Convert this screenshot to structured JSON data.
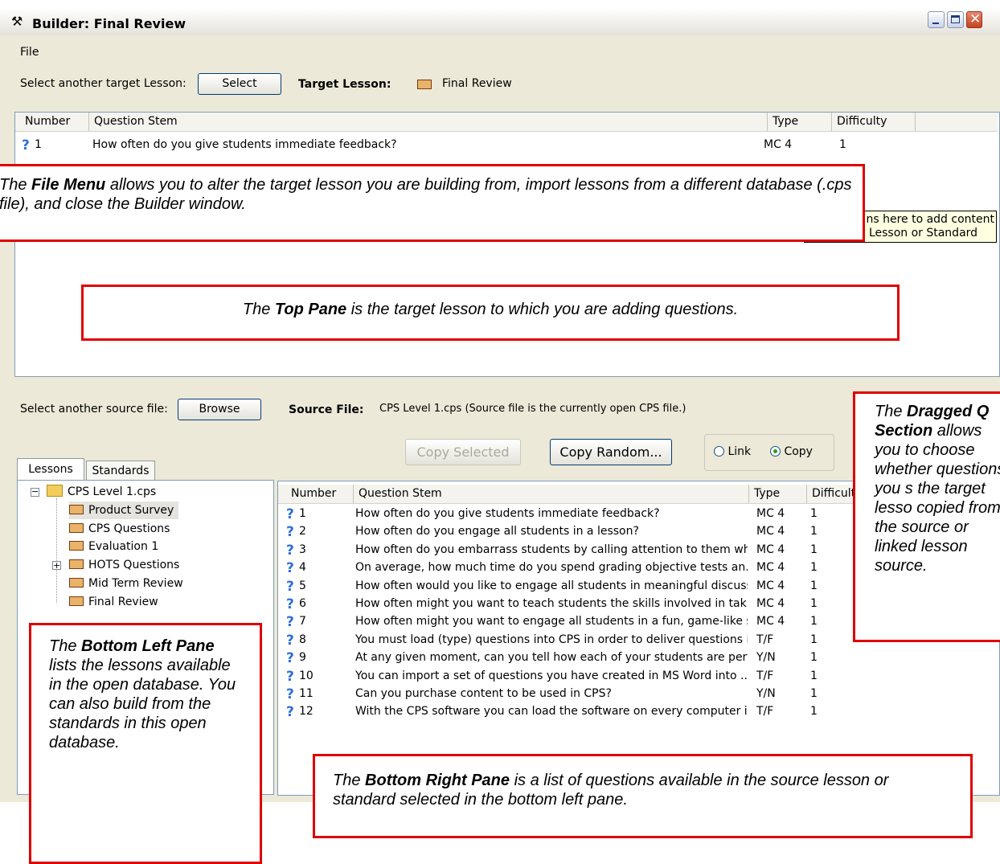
{
  "window": {
    "title": "Builder: Final Review"
  },
  "menu": {
    "file": "File"
  },
  "target": {
    "select_label": "Select another target Lesson:",
    "select_button": "Select",
    "target_label": "Target Lesson:",
    "target_value": "Final Review"
  },
  "top_table": {
    "headers": {
      "number": "Number",
      "stem": "Question Stem",
      "type": "Type",
      "difficulty": "Difficulty"
    },
    "rows": [
      {
        "number": "1",
        "stem": "How often do you give students immediate feedback?",
        "type": "MC 4",
        "difficulty": "1"
      }
    ]
  },
  "tooltip": {
    "line1": "ns here to add content",
    "line2": "t Lesson or Standard"
  },
  "source": {
    "select_label": "Select another source file:",
    "browse_button": "Browse",
    "source_label": "Source File:",
    "source_value": "CPS Level 1.cps  (Source file is the currently open CPS file.)",
    "copy_selected": "Copy Selected",
    "copy_random": "Copy Random...",
    "link_label": "Link",
    "copy_label": "Copy"
  },
  "tabs": {
    "lessons": "Lessons",
    "standards": "Standards"
  },
  "tree": {
    "root": "CPS Level 1.cps",
    "items": [
      {
        "label": "Product Survey"
      },
      {
        "label": "CPS Questions"
      },
      {
        "label": "Evaluation 1"
      },
      {
        "label": "HOTS Questions"
      },
      {
        "label": "Mid Term Review"
      },
      {
        "label": "Final Review"
      }
    ]
  },
  "bottom_table": {
    "headers": {
      "number": "Number",
      "stem": "Question Stem",
      "type": "Type",
      "difficulty": "Difficult"
    },
    "rows": [
      {
        "number": "1",
        "stem": "How often do you give students immediate feedback?",
        "type": "MC 4",
        "difficulty": "1"
      },
      {
        "number": "2",
        "stem": "How often do you engage all students in a lesson?",
        "type": "MC 4",
        "difficulty": "1"
      },
      {
        "number": "3",
        "stem": "How often do you embarrass students by calling attention to them whe...",
        "type": "MC 4",
        "difficulty": "1"
      },
      {
        "number": "4",
        "stem": "On average, how much time do you spend  grading objective tests an...",
        "type": "MC 4",
        "difficulty": "1"
      },
      {
        "number": "5",
        "stem": "How often would you like to engage all students in meaningful discussi...",
        "type": "MC 4",
        "difficulty": "1"
      },
      {
        "number": "6",
        "stem": "How often might you want to teach students the skills involved in takin...",
        "type": "MC 4",
        "difficulty": "1"
      },
      {
        "number": "7",
        "stem": "How often might you want to engage all students in a fun, game-like st...",
        "type": "MC 4",
        "difficulty": "1"
      },
      {
        "number": "8",
        "stem": "You must load (type) questions into CPS in order to deliver questions in...",
        "type": "T/F",
        "difficulty": "1"
      },
      {
        "number": "9",
        "stem": "At any given moment, can you tell how each of your students are perf...",
        "type": "Y/N",
        "difficulty": "1"
      },
      {
        "number": "10",
        "stem": "You can import a set of questions you have created in MS Word into ...",
        "type": "T/F",
        "difficulty": "1"
      },
      {
        "number": "11",
        "stem": "Can you purchase content to be used in CPS?",
        "type": "Y/N",
        "difficulty": "1"
      },
      {
        "number": "12",
        "stem": "With the CPS software you can load the software on every computer i...",
        "type": "T/F",
        "difficulty": "1"
      }
    ]
  },
  "callouts": {
    "file_menu": {
      "pre": "The ",
      "bold": "File Menu",
      "post": " allows you to alter the target lesson you are building from, import lessons from a different database (.cps file), and close the Builder window."
    },
    "top_pane": {
      "pre": "The ",
      "bold": "Top Pane",
      "post": " is the target lesson to which you are adding questions."
    },
    "dragged": {
      "pre": "The ",
      "bold": "Dragged Q Section",
      "post": " allows you to choose whether questions you s the target lesso copied from the source or linked lesson source."
    },
    "bottom_left": {
      "pre": "The ",
      "bold": "Bottom Left Pane",
      "post": " lists the lessons available in the open database. You can also build from the standards in this open database."
    },
    "bottom_right": {
      "pre": "The ",
      "bold": "Bottom Right Pane",
      "post": " is a list of questions available in the source lesson or standard selected in the bottom left pane."
    }
  }
}
